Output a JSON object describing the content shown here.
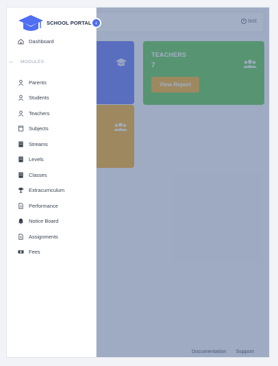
{
  "topbar": {
    "username": "test"
  },
  "cards": {
    "teachers": {
      "title": "TEACHERS",
      "count": "7",
      "button": "View Report"
    }
  },
  "footer": {
    "documentation": "Documentation",
    "support": "Support"
  },
  "sidebar": {
    "brand": "SCHOOL PORTAL",
    "dashboard": "Dashboard",
    "section_label": "MODULES",
    "items": [
      {
        "label": "Parents",
        "icon": "user-icon"
      },
      {
        "label": "Students",
        "icon": "user-icon"
      },
      {
        "label": "Teachers",
        "icon": "user-icon"
      },
      {
        "label": "Subjects",
        "icon": "book-icon"
      },
      {
        "label": "Streams",
        "icon": "building-icon"
      },
      {
        "label": "Levels",
        "icon": "building-icon"
      },
      {
        "label": "Classes",
        "icon": "building-icon"
      },
      {
        "label": "Extracurriculum",
        "icon": "trophy-icon"
      },
      {
        "label": "Performance",
        "icon": "document-icon"
      },
      {
        "label": "Notice Board",
        "icon": "bell-icon"
      },
      {
        "label": "Assignments",
        "icon": "document-icon"
      },
      {
        "label": "Fees",
        "icon": "money-icon"
      }
    ]
  },
  "colors": {
    "accent": "#4f6ef2",
    "students_card": "#6a7cf3",
    "teachers_card": "#66c95a",
    "parents_card": "#f2b136",
    "overlay": "rgba(71,95,138,0.5)"
  }
}
